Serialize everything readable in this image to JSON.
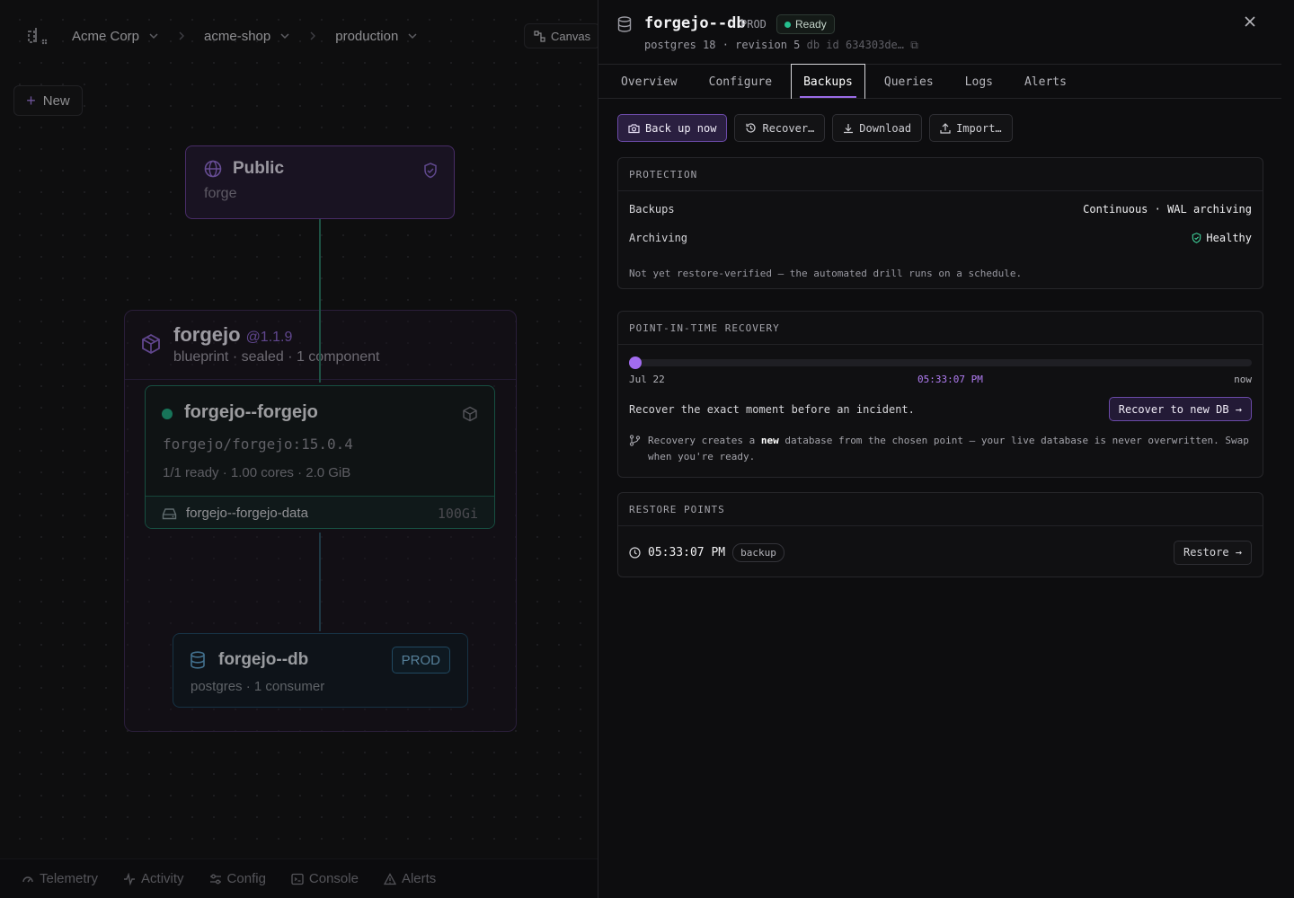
{
  "topbar": {
    "org": "Acme Corp",
    "project": "acme-shop",
    "env": "production",
    "canvas_label": "Canvas"
  },
  "canvas": {
    "new_label": "New",
    "public_node": {
      "title": "Public",
      "subtitle": "forge"
    },
    "blueprint": {
      "name": "forgejo",
      "version": "@1.1.9",
      "subtitle": "blueprint · sealed · 1 component"
    },
    "service_node": {
      "title": "forgejo--forgejo",
      "image": "forgejo/forgejo:15.0.4",
      "meta": "1/1 ready · 1.00 cores · 2.0 GiB",
      "volume_name": "forgejo--forgejo-data",
      "volume_size": "100Gi"
    },
    "db_node": {
      "title": "forgejo--db",
      "badge": "PROD",
      "subtitle": "postgres · 1 consumer"
    }
  },
  "bottombar": {
    "items": [
      "Telemetry",
      "Activity",
      "Config",
      "Console",
      "Alerts"
    ]
  },
  "panel": {
    "title": "forgejo--db",
    "env_tag": "PROD",
    "status": "Ready",
    "meta": "postgres 18 · revision 5",
    "db_id": "db id 634303de…",
    "tabs": [
      "Overview",
      "Configure",
      "Backups",
      "Queries",
      "Logs",
      "Alerts"
    ],
    "active_tab": "Backups",
    "actions": {
      "backup_now": "Back up now",
      "recover": "Recover…",
      "download": "Download",
      "import": "Import…"
    },
    "protection": {
      "heading": "PROTECTION",
      "backups_label": "Backups",
      "backups_value": "Continuous · WAL archiving",
      "archiving_label": "Archiving",
      "archiving_value": "Healthy",
      "note": "Not yet restore-verified — the automated drill runs on a schedule."
    },
    "pitr": {
      "heading": "POINT-IN-TIME RECOVERY",
      "start_label": "Jul 22",
      "selected_label": "05:33:07 PM",
      "end_label": "now",
      "position": 0.0,
      "description": "Recover the exact moment before an incident.",
      "recover_button": "Recover to new DB →",
      "info_prefix": "Recovery creates a ",
      "info_bold": "new",
      "info_suffix": " database from the chosen point — your live database is never overwritten. Swap when you're ready."
    },
    "restore_points": {
      "heading": "RESTORE POINTS",
      "items": [
        {
          "time": "05:33:07 PM",
          "tag": "backup",
          "action": "Restore →"
        }
      ]
    }
  },
  "colors": {
    "accent": "#8b55e0",
    "healthy": "#3fd19a",
    "ready_dot": "#25c08e"
  }
}
